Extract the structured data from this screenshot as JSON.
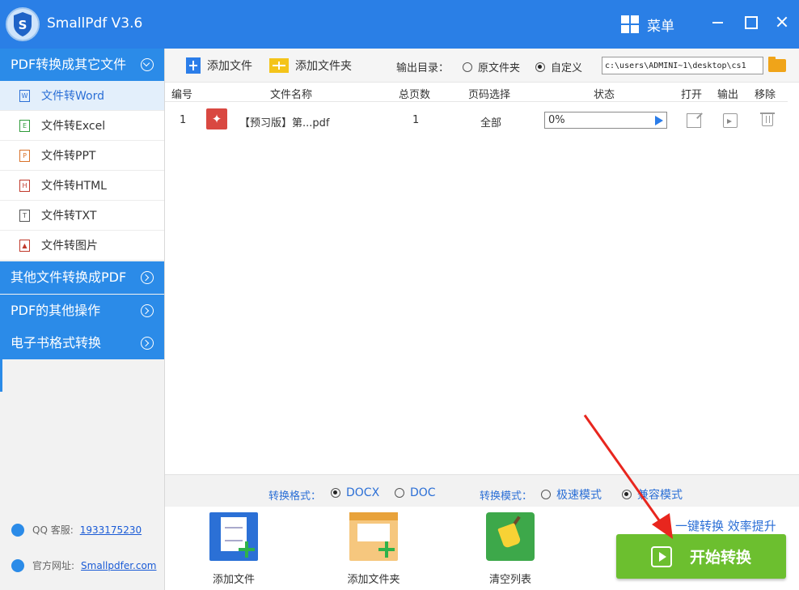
{
  "app": {
    "title": "SmallPdf V3.6",
    "menu_label": "菜单"
  },
  "sidebar": {
    "sections": [
      {
        "label": "PDF转换成其它文件",
        "expanded": true,
        "items": [
          {
            "label": "文件转Word",
            "active": true,
            "icon": "word-icon"
          },
          {
            "label": "文件转Excel",
            "icon": "excel-icon"
          },
          {
            "label": "文件转PPT",
            "icon": "ppt-icon"
          },
          {
            "label": "文件转HTML",
            "icon": "html-icon"
          },
          {
            "label": "文件转TXT",
            "icon": "txt-icon"
          },
          {
            "label": "文件转图片",
            "icon": "image-icon"
          }
        ]
      },
      {
        "label": "其他文件转换成PDF",
        "expanded": false
      },
      {
        "label": "PDF的其他操作",
        "expanded": false
      },
      {
        "label": "电子书格式转换",
        "expanded": false
      }
    ],
    "footer": {
      "qq_label": "QQ 客服:",
      "qq_value": "1933175230",
      "site_label": "官方网址:",
      "site_value": "Smallpdfer.com"
    }
  },
  "toolbar": {
    "add_file": "添加文件",
    "add_folder": "添加文件夹",
    "output_label": "输出目录：",
    "radio_source": "原文件夹",
    "radio_custom": "自定义",
    "selected_output": "custom",
    "path": "c:\\users\\ADMINI~1\\desktop\\cs1"
  },
  "table": {
    "headers": [
      "编号",
      "文件名称",
      "总页数",
      "页码选择",
      "状态",
      "打开",
      "输出",
      "移除"
    ],
    "rows": [
      {
        "index": "1",
        "name": "【预习版】第...pdf",
        "pages": "1",
        "range": "全部",
        "progress": 0,
        "progress_text": "0%"
      }
    ]
  },
  "format_bar": {
    "format_label": "转换格式：",
    "format_options": [
      "DOCX",
      "DOC"
    ],
    "format_selected": "DOCX",
    "mode_label": "转换模式：",
    "mode_options": [
      "极速模式",
      "兼容模式"
    ],
    "mode_selected": "兼容模式"
  },
  "bottom": {
    "add_file": "添加文件",
    "add_folder": "添加文件夹",
    "clear_list": "清空列表",
    "slogan": "一键转换  效率提升",
    "start": "开始转换"
  },
  "colors": {
    "primary": "#2a7fe6",
    "sidebar_header": "#2b8be8",
    "start_button": "#6cbf2f",
    "annotation_arrow": "#e8261e"
  }
}
